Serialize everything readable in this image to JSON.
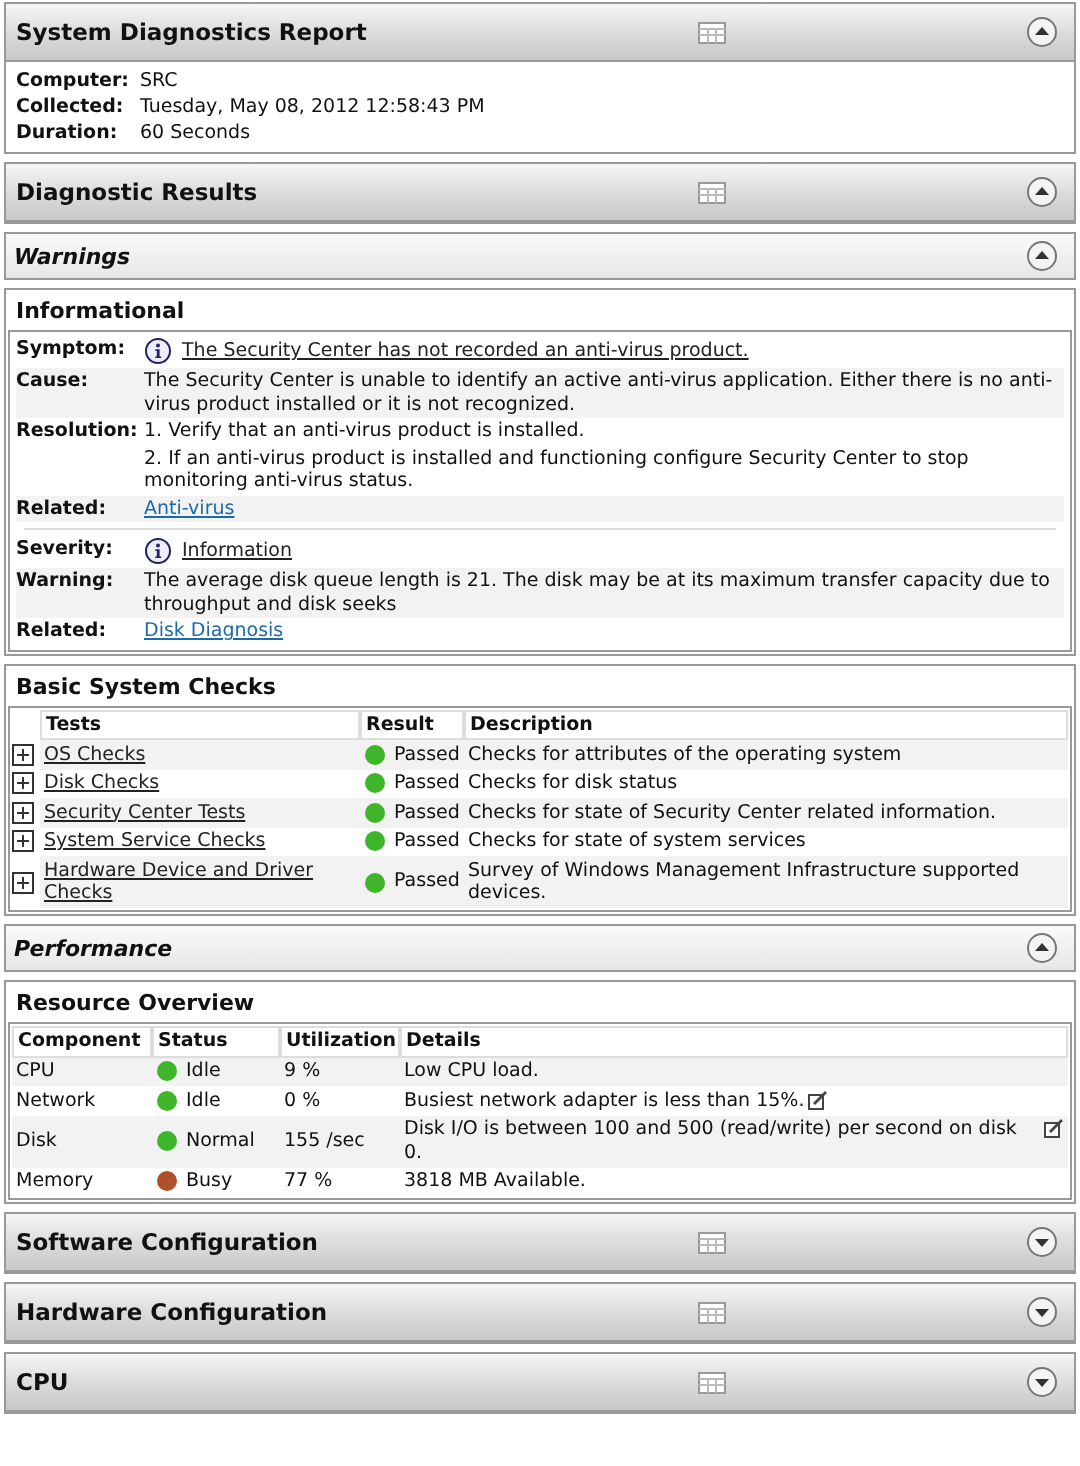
{
  "sections": [
    {
      "kind": "major",
      "title": "System Diagnostics Report",
      "expanded": true,
      "fields": [
        {
          "label": "Computer:",
          "value": "SRC"
        },
        {
          "label": "Collected:",
          "value": "Tuesday, May 08, 2012 12:58:43 PM"
        },
        {
          "label": "Duration:",
          "value": "60 Seconds"
        }
      ]
    },
    {
      "kind": "major",
      "title": "Diagnostic Results",
      "expanded": true
    },
    {
      "kind": "minor",
      "title": "Warnings",
      "expanded": true
    },
    {
      "kind": "informational",
      "title": "Informational",
      "groups": [
        [
          {
            "label": "Symptom:",
            "kind": "info",
            "texts": [
              "The Security Center has not recorded an anti-virus product."
            ]
          },
          {
            "label": "Cause:",
            "kind": "text",
            "texts": [
              "The Security Center is unable to identify an active anti-virus application. Either there is no anti-virus product installed or it is not recognized."
            ]
          },
          {
            "label": "Resolution:",
            "kind": "text",
            "texts": [
              "1. Verify that an anti-virus product is installed.",
              "2. If an anti-virus product is installed and functioning configure Security Center to stop monitoring anti-virus status."
            ]
          },
          {
            "label": "Related:",
            "kind": "link",
            "texts": [
              "Anti-virus"
            ]
          }
        ],
        [
          {
            "label": "Severity:",
            "kind": "info",
            "texts": [
              "Information"
            ]
          },
          {
            "label": "Warning:",
            "kind": "text",
            "texts": [
              "The average disk queue length is 21. The disk may be at its maximum transfer capacity due to throughput and disk seeks"
            ]
          },
          {
            "label": "Related:",
            "kind": "link",
            "texts": [
              "Disk Diagnosis"
            ]
          }
        ]
      ]
    },
    {
      "kind": "checks",
      "title": "Basic System Checks",
      "columns": [
        "Tests",
        "Result",
        "Description"
      ],
      "rows": [
        {
          "test": "OS Checks",
          "color": "#3fb52a",
          "result": "Passed",
          "description": "Checks for attributes of the operating system"
        },
        {
          "test": "Disk Checks",
          "color": "#3fb52a",
          "result": "Passed",
          "description": "Checks for disk status"
        },
        {
          "test": "Security Center Tests",
          "color": "#3fb52a",
          "result": "Passed",
          "description": "Checks for state of Security Center related information."
        },
        {
          "test": "System Service Checks",
          "color": "#3fb52a",
          "result": "Passed",
          "description": "Checks for state of system services"
        },
        {
          "test": "Hardware Device and Driver Checks",
          "color": "#3fb52a",
          "result": "Passed",
          "description": "Survey of Windows Management Infrastructure supported devices."
        }
      ]
    },
    {
      "kind": "minor",
      "title": "Performance",
      "expanded": true
    },
    {
      "kind": "resources",
      "title": "Resource Overview",
      "columns": [
        "Component",
        "Status",
        "Utilization",
        "Details"
      ],
      "rows": [
        {
          "component": "CPU",
          "color": "#3fb52a",
          "status": "Idle",
          "utilization": "9 %",
          "details": "Low CPU load.",
          "note": false
        },
        {
          "component": "Network",
          "color": "#3fb52a",
          "status": "Idle",
          "utilization": "0 %",
          "details": "Busiest network adapter is less than 15%.",
          "note": true
        },
        {
          "component": "Disk",
          "color": "#3fb52a",
          "status": "Normal",
          "utilization": "155 /sec",
          "details": "Disk I/O is between 100 and 500 (read/write) per second on disk 0.",
          "note": true
        },
        {
          "component": "Memory",
          "color": "#b0502a",
          "status": "Busy",
          "utilization": "77 %",
          "details": "3818 MB Available.",
          "note": false
        }
      ]
    },
    {
      "kind": "major",
      "title": "Software Configuration",
      "expanded": false
    },
    {
      "kind": "major",
      "title": "Hardware Configuration",
      "expanded": false
    },
    {
      "kind": "major",
      "title": "CPU",
      "expanded": false
    }
  ]
}
